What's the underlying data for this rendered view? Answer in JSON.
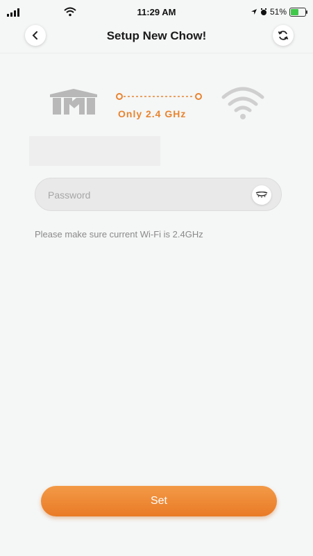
{
  "status_bar": {
    "time": "11:29 AM",
    "battery_text": "51%",
    "battery_level": 0.51
  },
  "header": {
    "title": "Setup New Chow!",
    "back_icon": "chevron-left-icon",
    "refresh_icon": "refresh-icon"
  },
  "diagram": {
    "band_label": "Only 2.4 GHz",
    "accent_color": "#e8842f"
  },
  "password": {
    "placeholder": "Password",
    "value": "",
    "toggle_icon": "eye-closed-icon"
  },
  "hint_text": "Please make sure current Wi-Fi is 2.4GHz",
  "set_button": {
    "label": "Set",
    "color": "#ee8834"
  }
}
